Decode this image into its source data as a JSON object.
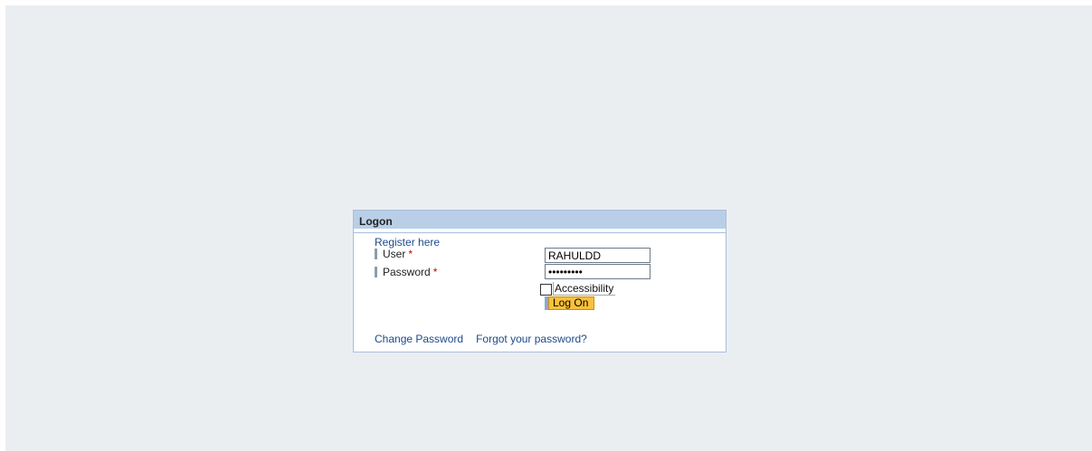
{
  "logon": {
    "title": "Logon",
    "register_link": "Register here",
    "user_label": "User",
    "password_label": "Password",
    "required_marker": "*",
    "user_value": "RAHULDD",
    "password_value": "•••••••••",
    "accessibility_label": "Accessibility",
    "accessibility_checked": false,
    "logon_button": "Log On",
    "change_password_link": "Change Password",
    "forgot_password_link": "Forgot your password?"
  },
  "colors": {
    "background": "#ebeef1",
    "header": "#b8cfe7",
    "border": "#a7c0dc",
    "link": "#1d4a8a",
    "button": "#f9c13a",
    "required": "#cc0000"
  }
}
